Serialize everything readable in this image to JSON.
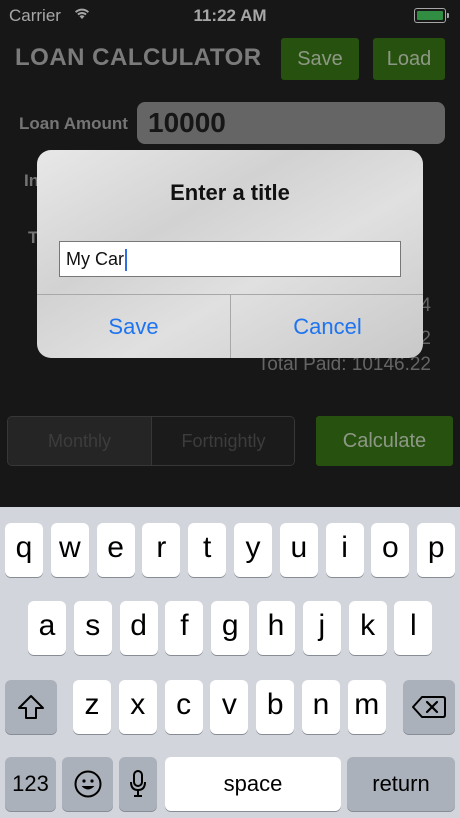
{
  "status": {
    "carrier": "Carrier",
    "time": "11:22 AM"
  },
  "header": {
    "title": "LOAN CALCULATOR",
    "save": "Save",
    "load": "Load"
  },
  "form": {
    "loan_amount_label": "Loan Amount",
    "loan_amount_value": "10000",
    "interest_label_partial": "In",
    "term_label_partial": "T"
  },
  "results": {
    "line1_partial": "4",
    "line2_partial": "2",
    "total_paid": "Total Paid: 10146.22"
  },
  "frequency": {
    "options": [
      "Monthly",
      "Fortnightly"
    ],
    "selected": "Monthly"
  },
  "calculate": "Calculate",
  "alert": {
    "title": "Enter a title",
    "input_value": "My Car",
    "save": "Save",
    "cancel": "Cancel"
  },
  "keyboard": {
    "row1": [
      "q",
      "w",
      "e",
      "r",
      "t",
      "y",
      "u",
      "i",
      "o",
      "p"
    ],
    "row2": [
      "a",
      "s",
      "d",
      "f",
      "g",
      "h",
      "j",
      "k",
      "l"
    ],
    "row3": [
      "z",
      "x",
      "c",
      "v",
      "b",
      "n",
      "m"
    ],
    "numbers": "123",
    "space": "space",
    "return": "return"
  },
  "colors": {
    "accent_green": "#3d7d16",
    "link_blue": "#1e74f0"
  }
}
